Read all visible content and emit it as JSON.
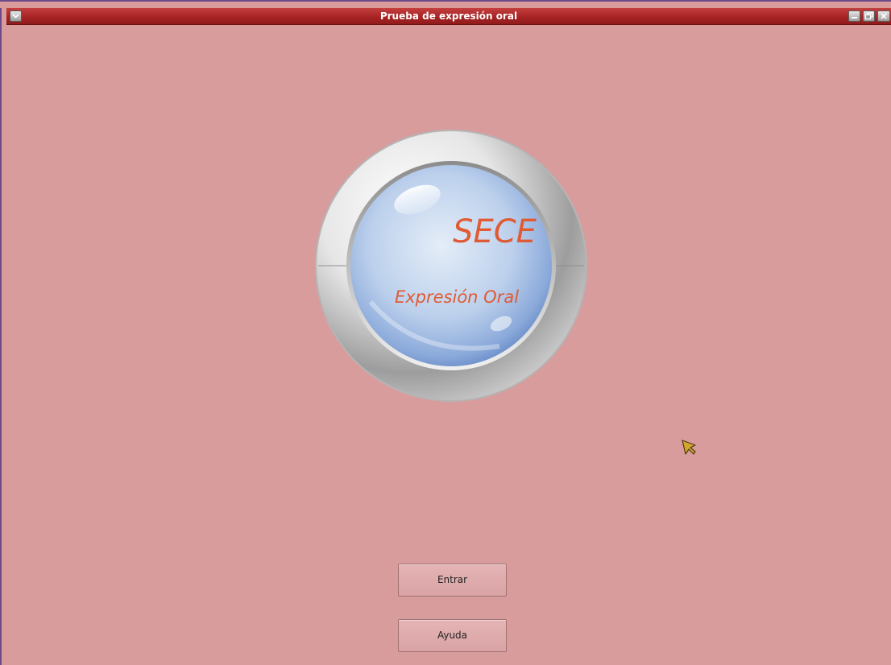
{
  "window": {
    "title": "Prueba de expresión oral",
    "controls": {
      "menu_icon": "chevron-down-icon",
      "minimize_icon": "minimize-icon",
      "maximize_icon": "restore-icon",
      "close_icon": "close-icon"
    }
  },
  "logo": {
    "title": "SECE",
    "subtitle": "Expresión Oral"
  },
  "buttons": {
    "entrar": "Entrar",
    "ayuda": "Ayuda"
  },
  "colors": {
    "background": "#d89c9d",
    "titlebar": "#a82425",
    "logo_text": "#e05a33",
    "cursor": "#d4a82c"
  }
}
